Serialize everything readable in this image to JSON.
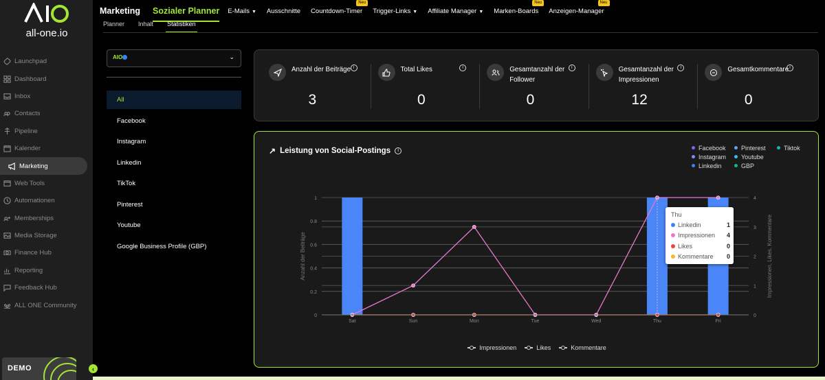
{
  "app": {
    "logo_mark": "AIO",
    "logo_text": "all-one.io",
    "demo_label": "DEMO"
  },
  "sidebar": {
    "items": [
      {
        "label": "Launchpad",
        "icon": "rocket-icon"
      },
      {
        "label": "Dashboard",
        "icon": "dashboard-icon"
      },
      {
        "label": "Inbox",
        "icon": "inbox-icon"
      },
      {
        "label": "Contacts",
        "icon": "contacts-icon"
      },
      {
        "label": "Pipeline",
        "icon": "pipeline-icon"
      },
      {
        "label": "Kalender",
        "icon": "calendar-icon"
      },
      {
        "label": "Marketing",
        "icon": "megaphone-icon",
        "active": true
      },
      {
        "label": "Web Tools",
        "icon": "web-icon"
      },
      {
        "label": "Automationen",
        "icon": "automation-icon"
      },
      {
        "label": "Memberships",
        "icon": "membership-icon"
      },
      {
        "label": "Media Storage",
        "icon": "media-icon"
      },
      {
        "label": "Finance Hub",
        "icon": "finance-icon"
      },
      {
        "label": "Reporting",
        "icon": "reporting-icon"
      },
      {
        "label": "Feedback Hub",
        "icon": "feedback-icon"
      },
      {
        "label": "ALL ONE Community",
        "icon": "community-icon"
      }
    ]
  },
  "topnav": {
    "brand": "Marketing",
    "module": "Sozialer Planner",
    "items": [
      {
        "label": "E-Mails",
        "chevron": true,
        "badge": ""
      },
      {
        "label": "Ausschnitte",
        "chevron": false,
        "badge": ""
      },
      {
        "label": "Countdown-Timer",
        "chevron": false,
        "badge": "Neu"
      },
      {
        "label": "Trigger-Links",
        "chevron": true,
        "badge": ""
      },
      {
        "label": "Affiliate Manager",
        "chevron": true,
        "badge": ""
      },
      {
        "label": "Marken-Boards",
        "chevron": false,
        "badge": "Neu"
      },
      {
        "label": "Anzeigen-Manager",
        "chevron": false,
        "badge": "Neu"
      }
    ]
  },
  "subtabs": [
    "Planner",
    "Inhalt",
    "Statistiken"
  ],
  "filters": {
    "account_logo": "AIO",
    "items": [
      "All",
      "Facebook",
      "Instagram",
      "Linkedin",
      "TikTok",
      "Pinterest",
      "Youtube",
      "Google Business Profile (GBP)"
    ],
    "active": "All"
  },
  "stats": [
    {
      "label": "Anzahl der Beiträge",
      "value": "3",
      "icon": "send-icon"
    },
    {
      "label": "Total Likes",
      "value": "0",
      "icon": "thumbs-up-icon"
    },
    {
      "label": "Gesamtanzahl der Follower",
      "value": "0",
      "icon": "users-icon"
    },
    {
      "label": "Gesamtanzahl der Impressionen",
      "value": "12",
      "icon": "pointer-icon"
    },
    {
      "label": "Gesamtkommentare",
      "value": "0",
      "icon": "comment-icon"
    }
  ],
  "chart_title": "Leistung von Social-Postings",
  "legend_top": [
    {
      "label": "Facebook",
      "color": "#8b5cf6"
    },
    {
      "label": "Pinterest",
      "color": "#60a5fa"
    },
    {
      "label": "Tiktok",
      "color": "#14b8a6"
    },
    {
      "label": "Instagram",
      "color": "#818cf8"
    },
    {
      "label": "Youtube",
      "color": "#38bdf8"
    },
    {
      "label": "Linkedin",
      "color": "#3b82f6"
    },
    {
      "label": "GBP",
      "color": "#10b981"
    }
  ],
  "legend_bottom": [
    "Impressionen",
    "Likes",
    "Kommentare"
  ],
  "tooltip": {
    "title": "Thu",
    "rows": [
      {
        "label": "Linkedin",
        "value": "1",
        "color": "#3b82f6"
      },
      {
        "label": "Impressionen",
        "value": "4",
        "color": "#e879c9"
      },
      {
        "label": "Likes",
        "value": "0",
        "color": "#ef4444"
      },
      {
        "label": "Kommentare",
        "value": "0",
        "color": "#f5b82e"
      }
    ]
  },
  "chart_data": {
    "type": "bar",
    "categories": [
      "Sat",
      "Sun",
      "Mon",
      "Tue",
      "Wed",
      "Thu",
      "Fri"
    ],
    "ylabel": "Anzahl der Beiträge",
    "y2label": "Impressionen, Likes, Kommentare",
    "ylim": [
      0,
      1
    ],
    "y2lim": [
      0,
      4
    ],
    "yticks": [
      "0",
      "0.2",
      "0.4",
      "0.6",
      "0.8",
      "1"
    ],
    "y2ticks": [
      "0",
      "1",
      "2",
      "3",
      "4"
    ],
    "series": [
      {
        "name": "Linkedin",
        "type": "bar",
        "axis": "left",
        "color": "#4a86f7",
        "values": [
          1,
          0,
          0,
          0,
          0,
          1,
          1
        ]
      },
      {
        "name": "Impressionen",
        "type": "line",
        "axis": "right",
        "color": "#e879c9",
        "values": [
          0,
          1,
          3,
          0,
          0,
          4,
          4
        ]
      },
      {
        "name": "Likes",
        "type": "line",
        "axis": "right",
        "color": "#ef4444",
        "values": [
          0,
          0,
          0,
          0,
          0,
          0,
          0
        ]
      },
      {
        "name": "Kommentare",
        "type": "line",
        "axis": "right",
        "color": "#f5b82e",
        "values": [
          0,
          0,
          0,
          0,
          0,
          0,
          0
        ]
      }
    ],
    "grid": true,
    "legend": "top-right"
  }
}
